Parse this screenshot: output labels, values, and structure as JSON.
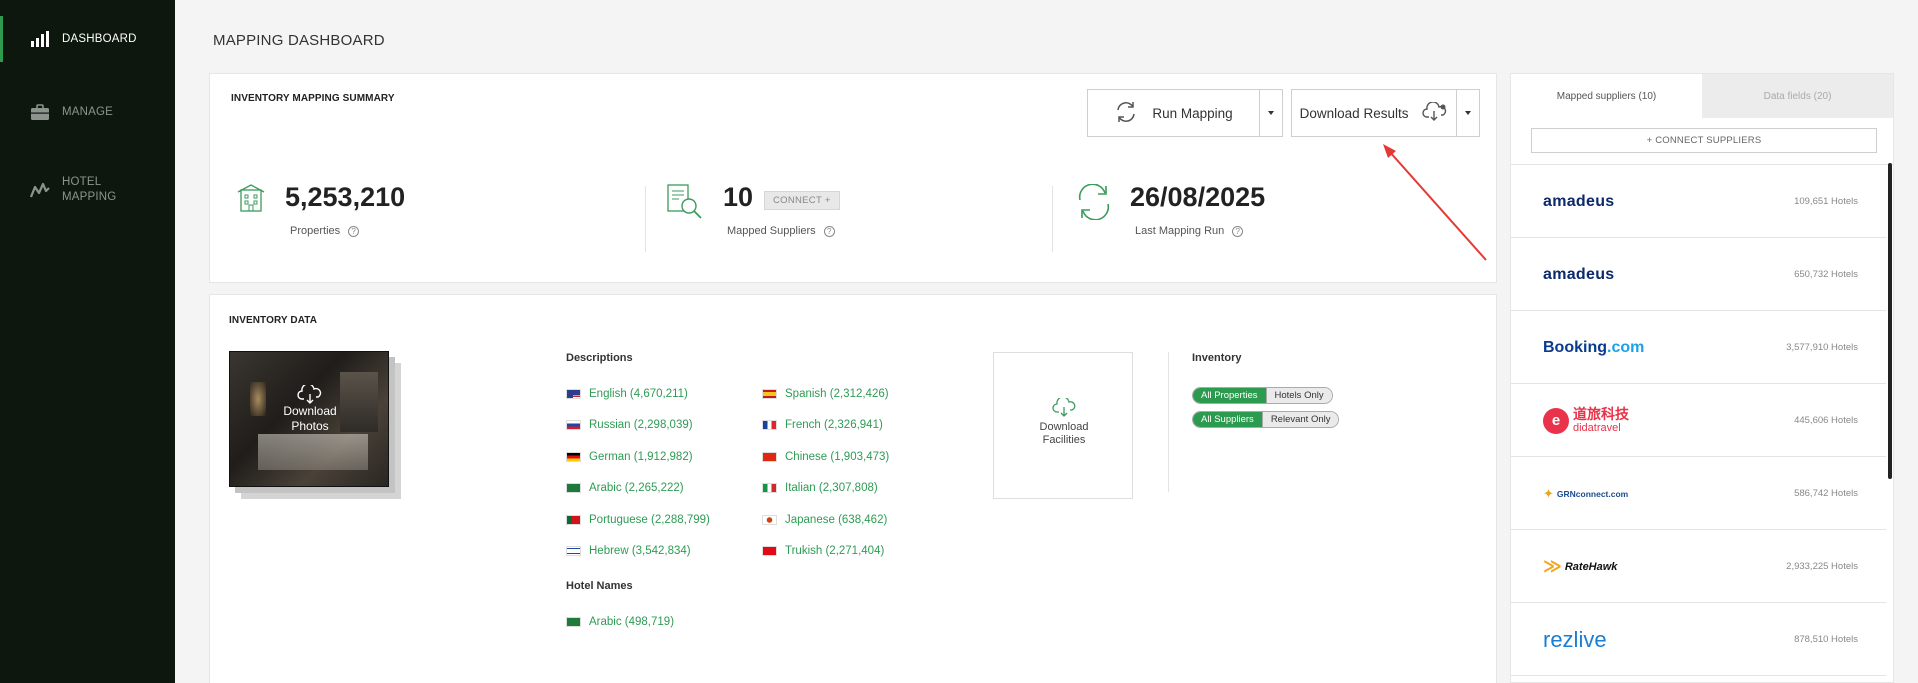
{
  "sidebar": {
    "items": [
      {
        "label": "DASHBOARD",
        "icon": "bar-chart-icon"
      },
      {
        "label": "MANAGE",
        "icon": "briefcase-icon"
      },
      {
        "label_line1": "HOTEL",
        "label_line2": "MAPPING",
        "icon": "activity-icon"
      }
    ]
  },
  "page": {
    "title": "MAPPING DASHBOARD"
  },
  "summary": {
    "title": "INVENTORY MAPPING SUMMARY",
    "run_mapping": "Run Mapping",
    "download_results": "Download Results",
    "stats": [
      {
        "value": "5,253,210",
        "label": "Properties"
      },
      {
        "value": "10",
        "label": "Mapped Suppliers",
        "badge": "CONNECT +"
      },
      {
        "value": "26/08/2025",
        "label": "Last Mapping Run"
      }
    ]
  },
  "inventory": {
    "title": "INVENTORY DATA",
    "download_photos_line1": "Download",
    "download_photos_line2": "Photos",
    "descriptions_title": "Descriptions",
    "descriptions": [
      {
        "flag": "us",
        "text": "English (4,670,211)"
      },
      {
        "flag": "es",
        "text": "Spanish (2,312,426)"
      },
      {
        "flag": "ru",
        "text": "Russian (2,298,039)"
      },
      {
        "flag": "fr",
        "text": "French (2,326,941)"
      },
      {
        "flag": "de",
        "text": "German (1,912,982)"
      },
      {
        "flag": "cn",
        "text": "Chinese (1,903,473)"
      },
      {
        "flag": "sa",
        "text": "Arabic (2,265,222)"
      },
      {
        "flag": "it",
        "text": "Italian (2,307,808)"
      },
      {
        "flag": "pt",
        "text": "Portuguese (2,288,799)"
      },
      {
        "flag": "jp",
        "text": "Japanese (638,462)"
      },
      {
        "flag": "il",
        "text": "Hebrew (3,542,834)"
      },
      {
        "flag": "tr",
        "text": "Trukish (2,271,404)"
      }
    ],
    "hotel_names_title": "Hotel Names",
    "hotel_names": [
      {
        "flag": "sa",
        "text": "Arabic (498,719)"
      }
    ],
    "download_facilities_line1": "Download",
    "download_facilities_line2": "Facilities",
    "inventory_title": "Inventory",
    "toggle1": {
      "on": "All Properties",
      "off": "Hotels Only"
    },
    "toggle2": {
      "on": "All Suppliers",
      "off": "Relevant Only"
    }
  },
  "suppliers_panel": {
    "tab_mapped": "Mapped suppliers (10)",
    "tab_fields": "Data fields (20)",
    "connect": "+ CONNECT SUPPLIERS",
    "rows": [
      {
        "logo": "amadeus",
        "count": "109,651 Hotels"
      },
      {
        "logo": "amadeus",
        "count": "650,732 Hotels"
      },
      {
        "logo": "Booking.com",
        "count": "3,577,910 Hotels"
      },
      {
        "logo": "didatravel",
        "count": "445,606 Hotels"
      },
      {
        "logo": "GRNconnect.com",
        "count": "586,742 Hotels"
      },
      {
        "logo": "RateHawk",
        "count": "2,933,225 Hotels"
      },
      {
        "logo": "rezlive",
        "count": "878,510 Hotels"
      }
    ],
    "logo_text": {
      "amadeus": "amadeus",
      "booking_a": "Booking",
      "booking_b": ".com",
      "dida_cn": "道旅科技",
      "dida_en": "didatravel",
      "grn": "GRNconnect.com",
      "ratehawk": "RateHawk",
      "rezlive": "rezlive"
    }
  },
  "colors": {
    "accent": "#2d9b4f",
    "sidebar": "#0e170e",
    "arrow": "#e53935"
  }
}
